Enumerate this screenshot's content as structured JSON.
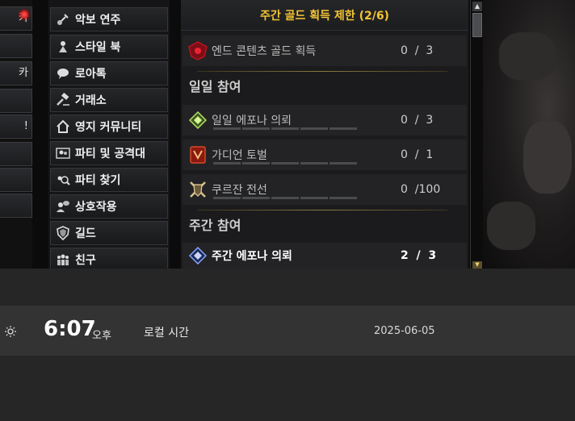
{
  "menu": {
    "items": [
      {
        "label": "악보 연주",
        "icon": "guitar-icon"
      },
      {
        "label": "스타일 북",
        "icon": "style-book-icon"
      },
      {
        "label": "로아톡",
        "icon": "chat-bubble-icon"
      },
      {
        "label": "거래소",
        "icon": "gavel-icon"
      },
      {
        "label": "영지 커뮤니티",
        "icon": "house-icon"
      },
      {
        "label": "파티 및 공격대",
        "icon": "party-icon"
      },
      {
        "label": "파티 찾기",
        "icon": "party-search-icon"
      },
      {
        "label": "상호작용",
        "icon": "interaction-icon"
      },
      {
        "label": "길드",
        "icon": "shield-icon"
      },
      {
        "label": "친구",
        "icon": "friends-icon"
      }
    ]
  },
  "left_col": {
    "items": [
      "카",
      "",
      "카",
      "",
      "!",
      "",
      "",
      ""
    ]
  },
  "panel": {
    "title": "주간 골드 획득 제한 (2/6)",
    "end_content": {
      "name": "엔드 콘텐츠 골드 획득",
      "count": "0  /  3"
    },
    "daily_section": "일일 참여",
    "daily": [
      {
        "name": "일일 에포나 의뢰",
        "count": "0  /  3",
        "pips": 5
      },
      {
        "name": "가디언 토벌",
        "count": "0  /  1",
        "pips": 5
      },
      {
        "name": "쿠르잔 전선",
        "count": "0  /100",
        "pips": 5
      }
    ],
    "weekly_section": "주간 참여",
    "weekly": [
      {
        "name": "주간 에포나 의뢰",
        "count": "2  /  3"
      }
    ]
  },
  "taskbar": {
    "time": "6:07",
    "ampm": "오후",
    "timezone": "로컬 시간",
    "date": "2025-06-05"
  },
  "colors": {
    "title_gold": "#f5c534",
    "accent_red": "#c0121e"
  }
}
